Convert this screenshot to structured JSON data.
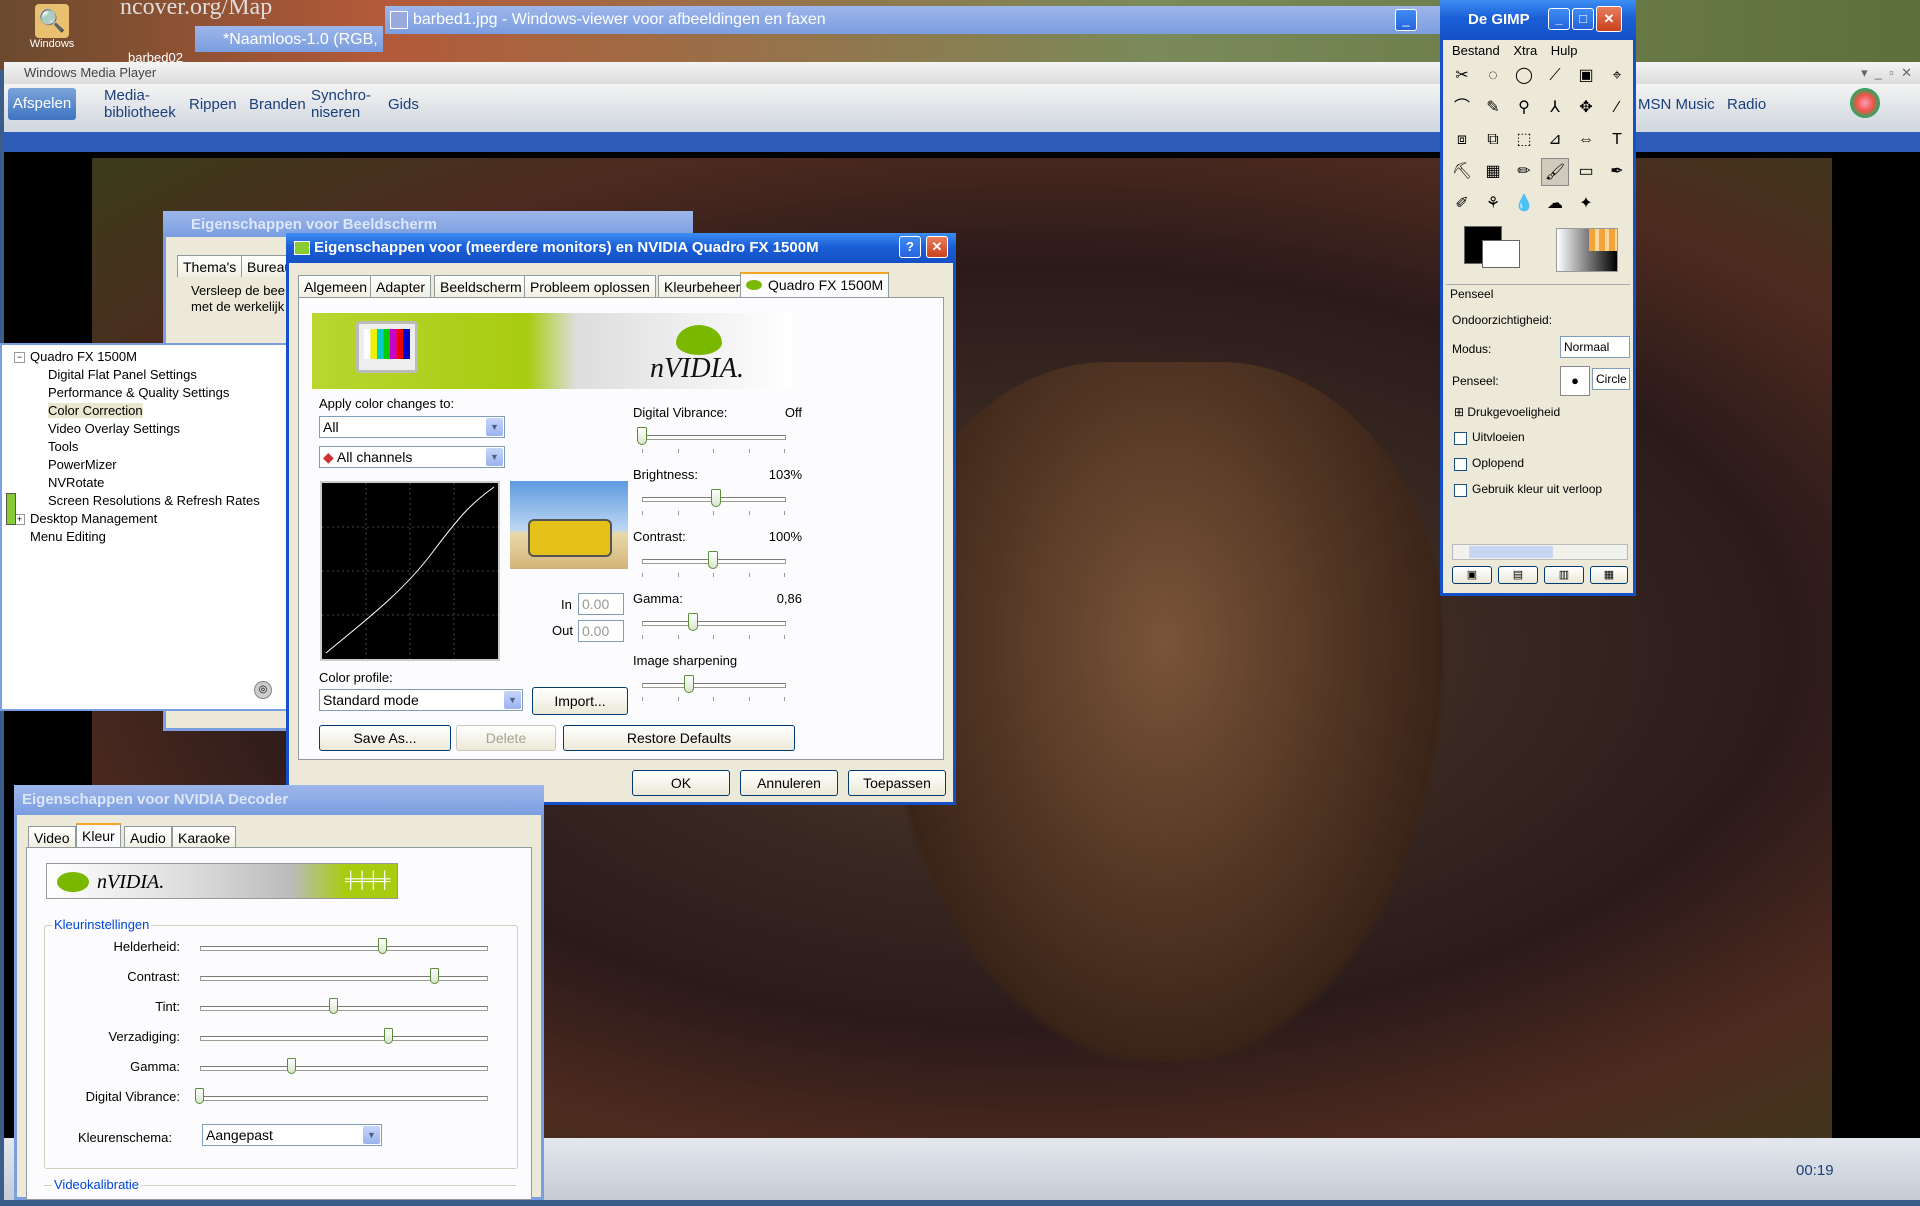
{
  "desktop": {
    "icon_label": "Windows",
    "bg_snippet": "ncover.org/Map"
  },
  "image_viewer": {
    "title": "barbed1.jpg - Windows-viewer voor afbeeldingen en faxen"
  },
  "gimp_image": {
    "title": "*Naamloos-1.0 (RGB,"
  },
  "taskbar_hint": {
    "label": "barbed02"
  },
  "wmp": {
    "title": "Windows Media Player",
    "menu": [
      "Afspelen",
      "Media-\nbibliotheek",
      "Rippen",
      "Branden",
      "Synchro-\nniseren",
      "Gids"
    ],
    "right_menu": [
      "MSN Music",
      "Radio"
    ],
    "time": "00:19"
  },
  "display_props": {
    "title": "Eigenschappen voor Beeldscherm",
    "tabs": [
      "Thema's",
      "Bureau"
    ],
    "text": "Versleep de bee\nmet de werkelijk"
  },
  "nvidia_tree": {
    "items": [
      {
        "label": "Quadro FX 1500M",
        "level": 0,
        "expander": "−"
      },
      {
        "label": "Digital Flat Panel Settings",
        "level": 1
      },
      {
        "label": "Performance & Quality Settings",
        "level": 1
      },
      {
        "label": "Color Correction",
        "level": 1,
        "selected": true
      },
      {
        "label": "Video Overlay Settings",
        "level": 1
      },
      {
        "label": "Tools",
        "level": 1
      },
      {
        "label": "PowerMizer",
        "level": 1
      },
      {
        "label": "NVRotate",
        "level": 1
      },
      {
        "label": "Screen Resolutions & Refresh Rates",
        "level": 1
      },
      {
        "label": "Desktop Management",
        "level": 0,
        "expander": "+"
      },
      {
        "label": "Menu Editing",
        "level": 0
      }
    ]
  },
  "quadro": {
    "title": "Eigenschappen voor (meerdere monitors) en NVIDIA Quadro FX 1500M",
    "tabs": [
      "Algemeen",
      "Adapter",
      "Beeldscherm",
      "Probleem oplossen",
      "Kleurbeheer",
      "Quadro FX 1500M"
    ],
    "banner_logo": "nVIDIA.",
    "apply_label": "Apply color changes to:",
    "apply_value": "All",
    "channel_value": "All channels",
    "in_label": "In",
    "out_label": "Out",
    "in_value": "0.00",
    "out_value": "0.00",
    "profile_label": "Color profile:",
    "profile_value": "Standard mode",
    "import_label": "Import...",
    "save_label": "Save As...",
    "delete_label": "Delete",
    "restore_label": "Restore Defaults",
    "sliders": [
      {
        "name": "Digital Vibrance:",
        "value": "Off",
        "level": 0.0
      },
      {
        "name": "Brightness:",
        "value": "103%",
        "level": 0.52
      },
      {
        "name": "Contrast:",
        "value": "100%",
        "level": 0.5
      },
      {
        "name": "Gamma:",
        "value": "0,86",
        "level": 0.36
      },
      {
        "name": "Image sharpening",
        "value": "",
        "level": 0.33
      }
    ],
    "ok": "OK",
    "cancel": "Annuleren",
    "apply": "Toepassen"
  },
  "decoder": {
    "title": "Eigenschappen voor NVIDIA Decoder",
    "tabs": [
      "Video",
      "Kleur",
      "Audio",
      "Karaoke"
    ],
    "banner_logo": "nVIDIA.",
    "group": "Kleurinstellingen",
    "sliders": [
      {
        "name": "Helderheid:",
        "level": 0.64
      },
      {
        "name": "Contrast:",
        "level": 0.82
      },
      {
        "name": "Tint:",
        "level": 0.47
      },
      {
        "name": "Verzadiging:",
        "level": 0.66
      },
      {
        "name": "Gamma:",
        "level": 0.32
      },
      {
        "name": "Digital Vibrance:",
        "level": 0.0
      }
    ],
    "scheme_label": "Kleurenschema:",
    "scheme_value": "Aangepast",
    "group2": "Videokalibratie"
  },
  "gimp": {
    "title": "De GIMP",
    "menu": [
      "Bestand",
      "Xtra",
      "Hulp"
    ],
    "tools": [
      "✂",
      "◌",
      "◯",
      "⟋",
      "▣",
      "⌖",
      "⌒",
      "✎",
      "⚲",
      "⅄",
      "✥",
      "⁄",
      "⧈",
      "⧉",
      "⬚",
      "⊿",
      "⇔",
      "T",
      "⛏",
      "▦",
      "✏",
      "🖌",
      "▭",
      "✒",
      "✐",
      "⚘",
      "💧",
      "☁",
      "✦"
    ],
    "brush_panel": "Penseel",
    "opacity_label": "Ondoorzichtigheid:",
    "mode_label": "Modus:",
    "mode_value": "Normaal",
    "brush_label": "Penseel:",
    "brush_value": "Circle",
    "pressure": "Drukgevoeligheid",
    "options": [
      "Uitvloeien",
      "Oplopend",
      "Gebruik kleur uit verloop"
    ]
  }
}
